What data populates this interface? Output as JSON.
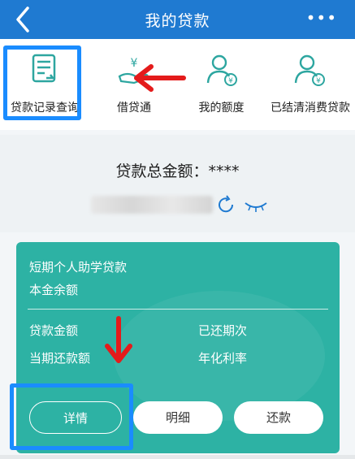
{
  "topbar": {
    "title": "我的贷款",
    "more": "•••"
  },
  "menu": {
    "items": [
      {
        "label": "贷款记录查询",
        "icon": "document-icon"
      },
      {
        "label": "借贷通",
        "icon": "hand-yen-icon"
      },
      {
        "label": "我的额度",
        "icon": "user-yen-icon"
      },
      {
        "label": "已结清消费贷款",
        "icon": "user-yen-icon"
      }
    ]
  },
  "summary": {
    "total_label": "贷款总金额：****"
  },
  "card": {
    "product": "短期个人助学贷款",
    "principal_label": "本金余额",
    "loan_amount_label": "贷款金额",
    "paid_periods_label": "已还期次",
    "current_due_label": "当期还款额",
    "annual_rate_label": "年化利率",
    "buttons": {
      "details": "详情",
      "breakdown": "明细",
      "repay": "还款"
    }
  },
  "colors": {
    "header": "#1f7ad1",
    "card": "#2db2a4",
    "highlight": "#1a8cff",
    "arrow": "#e41b1b"
  }
}
